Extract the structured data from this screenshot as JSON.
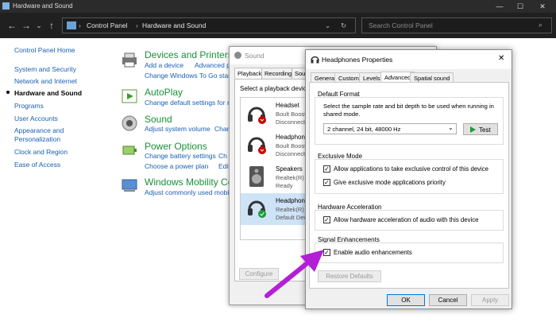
{
  "window": {
    "title": "Hardware and Sound"
  },
  "nav": {
    "address": [
      "Control Panel",
      "Hardware and Sound"
    ],
    "search_placeholder": "Search Control Panel"
  },
  "sidebar": {
    "items": [
      {
        "label": "Control Panel Home"
      },
      {
        "label": "System and Security"
      },
      {
        "label": "Network and Internet"
      },
      {
        "label": "Hardware and Sound"
      },
      {
        "label": "Programs"
      },
      {
        "label": "User Accounts"
      },
      {
        "label": "Appearance and Personalization"
      },
      {
        "label": "Clock and Region"
      },
      {
        "label": "Ease of Access"
      }
    ]
  },
  "categories": [
    {
      "title": "Devices and Printers",
      "links": [
        "Add a device",
        "Advanced p",
        "Change Windows To Go start"
      ],
      "icon": "printer-icon"
    },
    {
      "title": "AutoPlay",
      "links": [
        "Change default settings for m"
      ],
      "icon": "autoplay-icon"
    },
    {
      "title": "Sound",
      "links": [
        "Adjust system volume",
        "Chan"
      ],
      "icon": "speaker-icon"
    },
    {
      "title": "Power Options",
      "links": [
        "Change battery settings",
        "Ch",
        "Choose a power plan",
        "Edit"
      ],
      "icon": "power-icon"
    },
    {
      "title": "Windows Mobility Ce",
      "links": [
        "Adjust commonly used mobil"
      ],
      "icon": "mobility-icon"
    }
  ],
  "sound_dialog": {
    "title": "Sound",
    "tabs": [
      "Playback",
      "Recording",
      "Soun"
    ],
    "instruction": "Select a playback device b",
    "devices": [
      {
        "name": "Headset",
        "sub1": "Boult Boost H",
        "sub2": "Disconnected"
      },
      {
        "name": "Headphones",
        "sub1": "Boult Boost H",
        "sub2": "Disconnected"
      },
      {
        "name": "Speakers",
        "sub1": "Realtek(R) Au",
        "sub2": "Ready"
      },
      {
        "name": "Headphones",
        "sub1": "Realtek(R) Au",
        "sub2": "Default Devic"
      }
    ],
    "configure": "Configure"
  },
  "props_dialog": {
    "title": "Headphones Properties",
    "tabs": [
      "General",
      "Custom",
      "Levels",
      "Advanced",
      "Spatial sound"
    ],
    "default_format": {
      "label": "Default Format",
      "desc": "Select the sample rate and bit depth to be used when running in shared mode.",
      "selected": "2 channel, 24 bit, 48000 Hz",
      "test": "Test"
    },
    "exclusive": {
      "label": "Exclusive Mode",
      "opt1": "Allow applications to take exclusive control of this device",
      "opt2": "Give exclusive mode applications priority"
    },
    "hw_accel": {
      "label": "Hardware Acceleration",
      "opt1": "Allow hardware acceleration of audio with this device"
    },
    "signal": {
      "label": "Signal Enhancements",
      "opt1": "Enable audio enhancements"
    },
    "restore": "Restore Defaults",
    "ok": "OK",
    "cancel": "Cancel",
    "apply": "Apply"
  },
  "colors": {
    "arrow": "#b41fd6",
    "link": "#1a5fb4",
    "category": "#1a8f3a"
  }
}
